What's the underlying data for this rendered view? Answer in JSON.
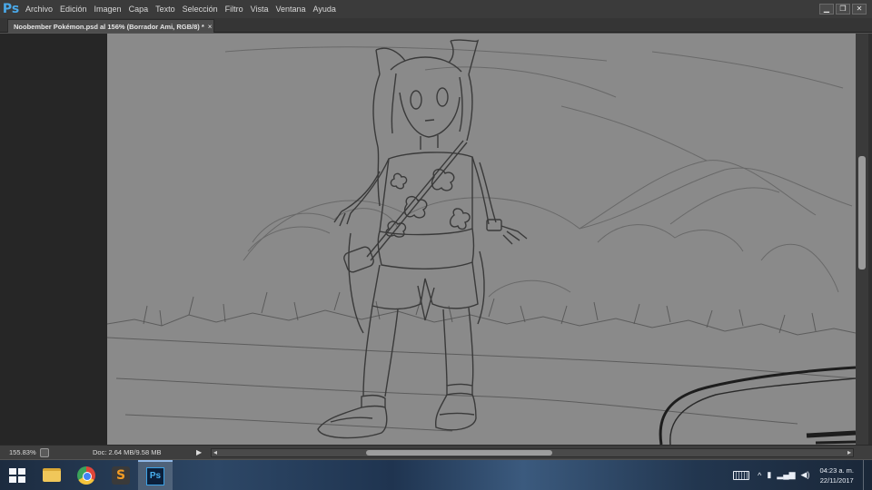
{
  "app": {
    "logo": "Ps",
    "menu": [
      "Archivo",
      "Edición",
      "Imagen",
      "Capa",
      "Texto",
      "Selección",
      "Filtro",
      "Vista",
      "Ventana",
      "Ayuda"
    ],
    "window_controls": {
      "minimize": "▁",
      "restore": "❐",
      "close": "✕"
    }
  },
  "document_tab": {
    "label": "Noobember Pokémon.psd al 156% (Borrador Ami, RGB/8) *",
    "close": "×"
  },
  "status": {
    "zoom": "155.83%",
    "doc_size": "Doc: 2.64 MB/9.58 MB",
    "arrow": "▶",
    "scroll_left": "◂",
    "scroll_right": "▸"
  },
  "taskbar": {
    "apps": [
      {
        "name": "start",
        "icon": "windows-start-icon"
      },
      {
        "name": "file-explorer",
        "icon": "folder-icon"
      },
      {
        "name": "chrome",
        "icon": "chrome-icon"
      },
      {
        "name": "sublime-text",
        "icon": "sublime-icon",
        "glyph": "S"
      },
      {
        "name": "photoshop",
        "icon": "photoshop-icon",
        "glyph": "Ps",
        "active": true
      }
    ],
    "tray": {
      "up_arrow": "^",
      "time": "04:23 a. m.",
      "date": "22/11/2017"
    }
  }
}
